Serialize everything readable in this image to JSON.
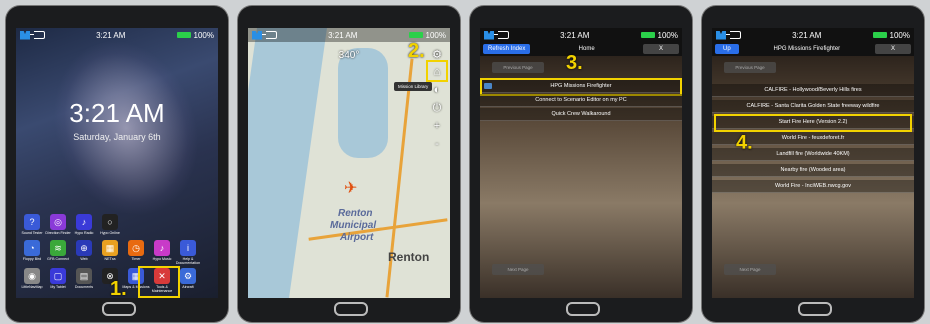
{
  "status": {
    "time": "3:21 AM",
    "battery": "100%"
  },
  "panel1": {
    "big_time": "3:21 AM",
    "date": "Saturday, January 6th",
    "step": "1.",
    "apps": [
      {
        "label": "Sound Tester",
        "icon": "?",
        "color": "#3a5ad8"
      },
      {
        "label": "Direction Finder",
        "icon": "◎",
        "color": "#8a3ad8"
      },
      {
        "label": "Hypo Radio",
        "icon": "♪",
        "color": "#3a3ad8"
      },
      {
        "label": "Hypo Online",
        "icon": "○",
        "color": "#222"
      },
      {
        "label": "Floppy Bird",
        "icon": "◔",
        "color": "#3a6ad8"
      },
      {
        "label": "GFB Connect",
        "icon": "≋",
        "color": "#3aa83a"
      },
      {
        "label": "Web",
        "icon": "⊕",
        "color": "#2a3ab8"
      },
      {
        "label": "NETxa",
        "icon": "▦",
        "color": "#e8a020"
      },
      {
        "label": "Timer",
        "icon": "◷",
        "color": "#e86a10"
      },
      {
        "label": "Hypo Music",
        "icon": "♪",
        "color": "#c83ac8"
      },
      {
        "label": "Help & Documentation",
        "icon": "i",
        "color": "#3a5ad8"
      },
      {
        "label": "LittleNavMap",
        "icon": "◉",
        "color": "#888"
      },
      {
        "label": "My Tablet",
        "icon": "▢",
        "color": "#3a3ad8"
      },
      {
        "label": "Documents",
        "icon": "▤",
        "color": "#555"
      },
      {
        "label": "",
        "icon": "⊗",
        "color": "#222"
      },
      {
        "label": "Maps & Missions",
        "icon": "▦",
        "color": "#3a5ad8"
      },
      {
        "label": "Tools & Maintenance",
        "icon": "✕",
        "color": "#d83a3a"
      },
      {
        "label": "Aircraft",
        "icon": "⚙",
        "color": "#3a6ad8"
      }
    ]
  },
  "panel2": {
    "heading": "340°",
    "step": "2.",
    "tooltip": "Mission Library",
    "map_labels": [
      "Renton",
      "Municipal",
      "Airport",
      "Renton"
    ]
  },
  "panel3": {
    "refresh": "Refresh Index",
    "title": "Home",
    "close": "X",
    "prev": "Previous Page",
    "next": "Next Page",
    "step": "3.",
    "rows": [
      "HPG Missions Firefighter",
      "Connect to Scenario Editor on my PC",
      "Quick Crew Walkaround"
    ]
  },
  "panel4": {
    "up": "Up",
    "title": "HPG Missions Firefighter",
    "close": "X",
    "prev": "Previous Page",
    "next": "Next Page",
    "step": "4.",
    "rows": [
      "CALFIRE - Hollywood/Beverly Hills fires",
      "CALFIRE - Santa Clarita Golden State freeway wildfire",
      "Start Fire Here (Version 2.2)",
      "World Fire - feuxdeforet.fr",
      "Landfill fire (Worldwide 40KM)",
      "Nearby fire (Wooded area)",
      "World Fire - InciWEB.nwcg.gov"
    ]
  }
}
